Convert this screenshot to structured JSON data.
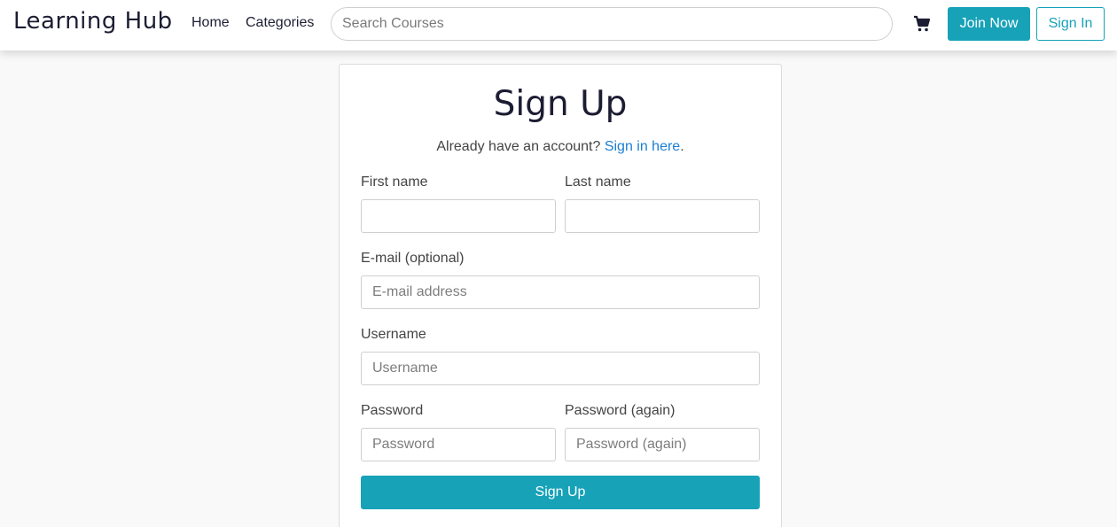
{
  "navbar": {
    "brand": "Learning Hub",
    "links": [
      {
        "label": "Home"
      },
      {
        "label": "Categories"
      }
    ],
    "search": {
      "placeholder": "Search Courses",
      "value": ""
    },
    "cart_icon": "shopping-cart-icon",
    "join_label": "Join Now",
    "signin_label": "Sign In",
    "accent_color": "#17a2b8"
  },
  "form": {
    "title": "Sign Up",
    "subtitle_text": "Already have an account?",
    "subtitle_link": "Sign in here",
    "subtitle_end": ".",
    "first_name": {
      "label": "First name",
      "placeholder": "",
      "value": ""
    },
    "last_name": {
      "label": "Last name",
      "placeholder": "",
      "value": ""
    },
    "email": {
      "label": "E-mail (optional)",
      "placeholder": "E-mail address",
      "value": ""
    },
    "username": {
      "label": "Username",
      "placeholder": "Username",
      "value": ""
    },
    "password": {
      "label": "Password",
      "placeholder": "Password",
      "value": ""
    },
    "password_again": {
      "label": "Password (again)",
      "placeholder": "Password (again)",
      "value": ""
    },
    "submit_label": "Sign Up"
  }
}
